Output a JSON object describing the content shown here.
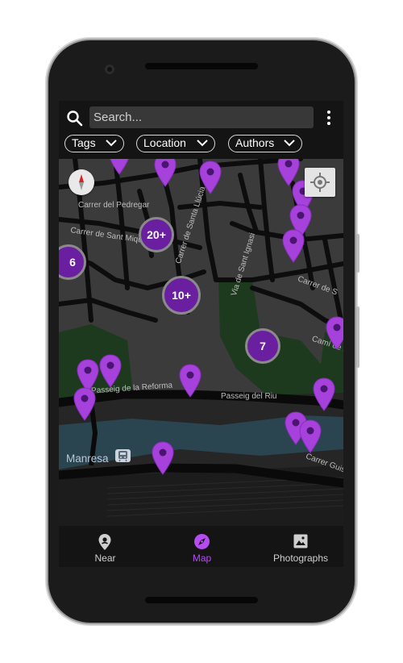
{
  "search": {
    "placeholder": "Search..."
  },
  "filters": [
    {
      "label": "Tags"
    },
    {
      "label": "Location"
    },
    {
      "label": "Authors"
    }
  ],
  "map": {
    "streets": [
      "Carrer del Pedregar",
      "Carrer de Sant Miquel",
      "Carrer de Santa Llúcia",
      "Via de Sant Ignasi",
      "Carrer de S",
      "Camí de la",
      "Passeig de la Reforma",
      "Passeig del Riu",
      "Carrer Guis"
    ],
    "city_label": "Manresa",
    "clusters": [
      "20+",
      "6",
      "10+",
      "7"
    ]
  },
  "bottom_nav": {
    "items": [
      {
        "label": "Near",
        "icon": "location-pin-icon",
        "active": false
      },
      {
        "label": "Map",
        "icon": "compass-icon",
        "active": true
      },
      {
        "label": "Photographs",
        "icon": "photo-icon",
        "active": false
      }
    ]
  },
  "colors": {
    "accent": "#b44cf2",
    "pin": "#a641dc",
    "cluster": "#6a1fa0",
    "background": "#141414",
    "map_base": "#3b3b3b",
    "roads": "#0d0d0d",
    "parks": "#1d3a1f",
    "river": "#2a4450"
  }
}
